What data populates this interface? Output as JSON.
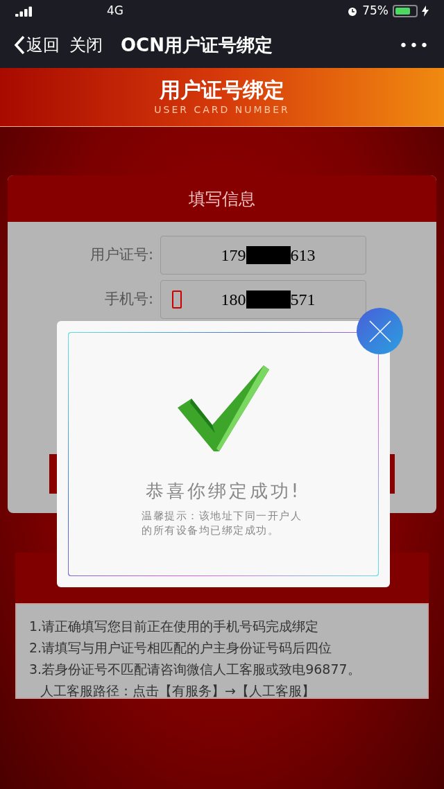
{
  "status_bar": {
    "network": "4G",
    "battery": "75%"
  },
  "nav": {
    "back": "返回",
    "close": "关闭",
    "title": "OCN用户证号绑定",
    "more": "•••"
  },
  "banner": {
    "title": "用户证号绑定",
    "subtitle": "USER CARD NUMBER"
  },
  "form": {
    "title": "填写信息",
    "fields": [
      {
        "label": "用户证号:",
        "value_start": "179",
        "value_end": "613",
        "kind": "plain"
      },
      {
        "label": "手机号:",
        "value_start": "180",
        "value_end": "571",
        "kind": "phone"
      }
    ]
  },
  "notes": [
    "1.请正确填写您目前正在使用的手机号码完成绑定",
    "2.请填写与用户证号相匹配的户主身份证号码后四位",
    "3.若身份证号不匹配请咨询微信人工客服或致电96877。",
    "人工客服路径：点击【有服务】→【人工客服】"
  ],
  "dialog": {
    "title": "恭喜你绑定成功!",
    "message": "温馨提示：该地址下同一开户人的所有设备均已绑定成功。"
  }
}
